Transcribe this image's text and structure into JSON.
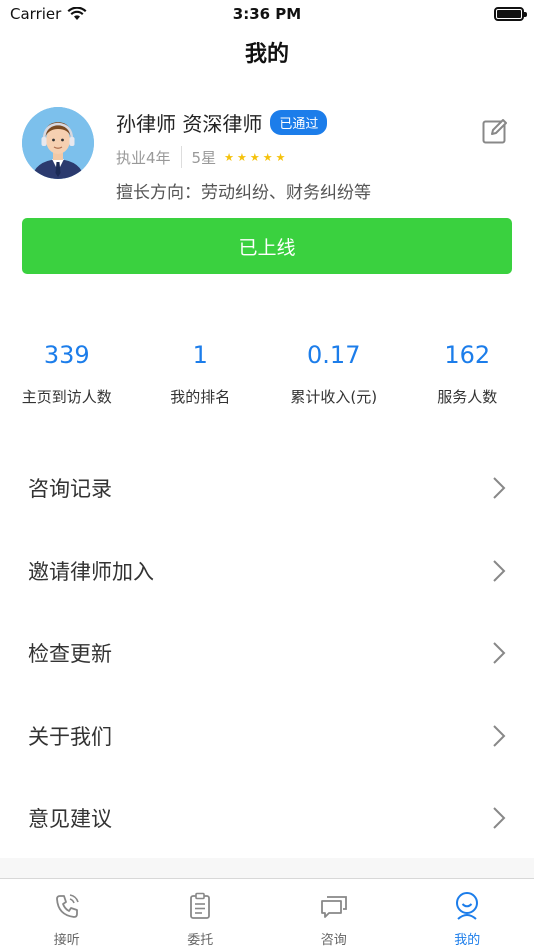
{
  "status_bar": {
    "carrier": "Carrier",
    "time": "3:36 PM"
  },
  "nav": {
    "title": "我的"
  },
  "profile": {
    "name": "孙律师 资深律师",
    "badge": "已通过",
    "experience": "执业4年",
    "rating_label": "5星",
    "rating_stars": 5,
    "specialty": "擅长方向：劳动纠纷、财务纠纷等"
  },
  "online_button": {
    "label": "已上线"
  },
  "stats": [
    {
      "value": "339",
      "label": "主页到访人数"
    },
    {
      "value": "1",
      "label": "我的排名"
    },
    {
      "value": "0.17",
      "label": "累计收入(元)"
    },
    {
      "value": "162",
      "label": "服务人数"
    }
  ],
  "menu": [
    {
      "label": "咨询记录"
    },
    {
      "label": "邀请律师加入"
    },
    {
      "label": "检查更新"
    },
    {
      "label": "关于我们"
    },
    {
      "label": "意见建议"
    }
  ],
  "tabs": [
    {
      "label": "接听",
      "icon": "phone-icon",
      "active": false
    },
    {
      "label": "委托",
      "icon": "clipboard-icon",
      "active": false
    },
    {
      "label": "咨询",
      "icon": "chat-icon",
      "active": false
    },
    {
      "label": "我的",
      "icon": "profile-icon",
      "active": true
    }
  ],
  "colors": {
    "accent": "#1c7dea",
    "online": "#3ad13f",
    "star": "#f5c20c"
  }
}
